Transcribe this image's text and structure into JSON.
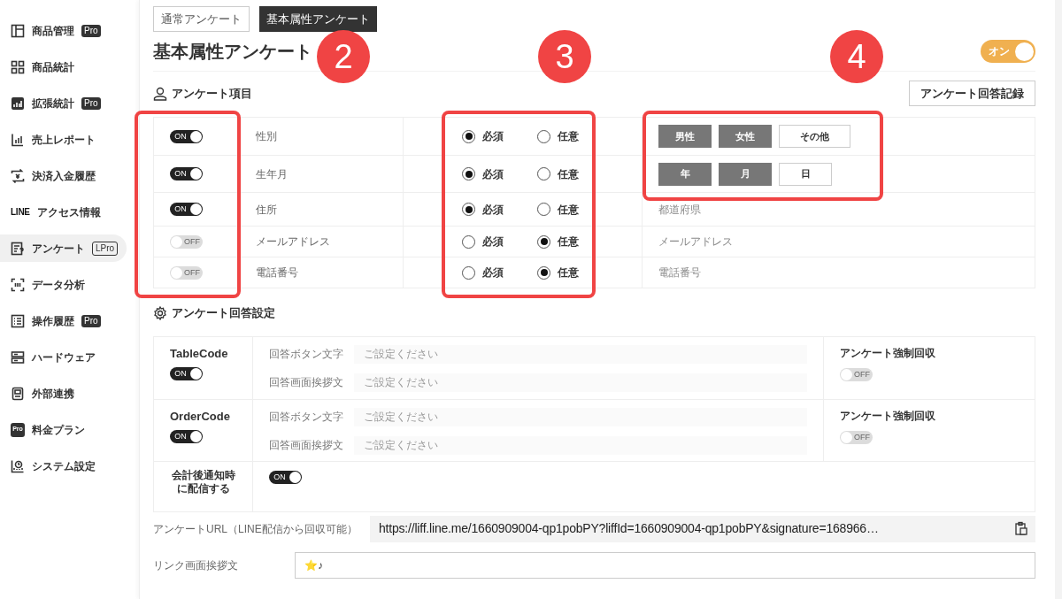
{
  "sidebar": {
    "items": [
      {
        "label": "商品管理",
        "badge": {
          "label": "Pro",
          "kind": "solid"
        },
        "selected": false
      },
      {
        "label": "商品統計",
        "selected": false
      },
      {
        "label": "拡張統計",
        "badge": {
          "label": "Pro",
          "kind": "solid"
        },
        "selected": false
      },
      {
        "label": "売上レポート",
        "selected": false
      },
      {
        "label": "決済入金履歴",
        "selected": false
      },
      {
        "icon_text": "LINE",
        "label": "アクセス情報",
        "selected": false
      },
      {
        "label": "アンケート",
        "badge": {
          "label": "LPro",
          "kind": "outline"
        },
        "selected": true
      },
      {
        "label": "データ分析",
        "selected": false
      },
      {
        "label": "操作履歴",
        "badge": {
          "label": "Pro",
          "kind": "solid"
        },
        "selected": false
      },
      {
        "label": "ハードウェア",
        "selected": false
      },
      {
        "label": "外部連携",
        "selected": false
      },
      {
        "icon_text": "Pro",
        "label": "料金プラン",
        "selected": false
      },
      {
        "label": "システム設定",
        "selected": false
      }
    ]
  },
  "tabs": [
    {
      "label": "通常アンケート",
      "selected": false
    },
    {
      "label": "基本属性アンケート",
      "selected": true
    }
  ],
  "page_title": "基本属性アンケート",
  "master_toggle": {
    "label": "オン",
    "on": true
  },
  "items_section": {
    "title": "アンケート項目",
    "record_button": "アンケート回答記録",
    "rows": [
      {
        "toggle": {
          "on": true,
          "label": "ON"
        },
        "name": "性別",
        "options": [
          {
            "label": "必須",
            "selected": true
          },
          {
            "label": "任意",
            "selected": false
          }
        ],
        "detail": {
          "kind": "choices",
          "choices": [
            {
              "label": "男性",
              "selected": true
            },
            {
              "label": "女性",
              "selected": true
            },
            {
              "label": "その他",
              "selected": false
            }
          ]
        }
      },
      {
        "toggle": {
          "on": true,
          "label": "ON"
        },
        "name": "生年月",
        "options": [
          {
            "label": "必須",
            "selected": true
          },
          {
            "label": "任意",
            "selected": false
          }
        ],
        "detail": {
          "kind": "choices",
          "choices": [
            {
              "label": "年",
              "selected": true
            },
            {
              "label": "月",
              "selected": true
            },
            {
              "label": "日",
              "selected": false
            }
          ]
        }
      },
      {
        "toggle": {
          "on": true,
          "label": "ON"
        },
        "name": "住所",
        "options": [
          {
            "label": "必須",
            "selected": true
          },
          {
            "label": "任意",
            "selected": false
          }
        ],
        "detail": {
          "kind": "text",
          "text": "都道府県"
        }
      },
      {
        "toggle": {
          "on": false,
          "label": "OFF"
        },
        "name": "メールアドレス",
        "options": [
          {
            "label": "必須",
            "selected": false
          },
          {
            "label": "任意",
            "selected": true
          }
        ],
        "detail": {
          "kind": "text",
          "text": "メールアドレス"
        }
      },
      {
        "toggle": {
          "on": false,
          "label": "OFF"
        },
        "name": "電話番号",
        "options": [
          {
            "label": "必須",
            "selected": false
          },
          {
            "label": "任意",
            "selected": true
          }
        ],
        "detail": {
          "kind": "text",
          "text": "電話番号"
        }
      }
    ]
  },
  "answer_section": {
    "title": "アンケート回答設定",
    "rows": [
      {
        "kind": "code",
        "name": "TableCode",
        "toggle": {
          "on": true,
          "label": "ON"
        },
        "fields": [
          {
            "label": "回答ボタン文字",
            "placeholder": "ご設定ください"
          },
          {
            "label": "回答画面挨拶文",
            "placeholder": "ご設定ください"
          }
        ],
        "force": {
          "label": "アンケート強制回収",
          "toggle": {
            "on": false,
            "label": "OFF"
          }
        }
      },
      {
        "kind": "code",
        "name": "OrderCode",
        "toggle": {
          "on": true,
          "label": "ON"
        },
        "fields": [
          {
            "label": "回答ボタン文字",
            "placeholder": "ご設定ください"
          },
          {
            "label": "回答画面挨拶文",
            "placeholder": "ご設定ください"
          }
        ],
        "force": {
          "label": "アンケート強制回収",
          "toggle": {
            "on": false,
            "label": "OFF"
          }
        }
      },
      {
        "kind": "notify",
        "name": "会計後通知時に配信する",
        "toggle": {
          "on": true,
          "label": "ON"
        }
      }
    ]
  },
  "url": {
    "label": "アンケートURL（LINE配信から回収可能）",
    "value": "https://liff.line.me/1660909004-qp1pobPY?liffId=1660909004-qp1pobPY&signature=168966…"
  },
  "greeting": {
    "label": "リンク画面挨拶文",
    "value": "⭐♪"
  },
  "annotations": [
    {
      "label": "2"
    },
    {
      "label": "3"
    },
    {
      "label": "4"
    }
  ]
}
